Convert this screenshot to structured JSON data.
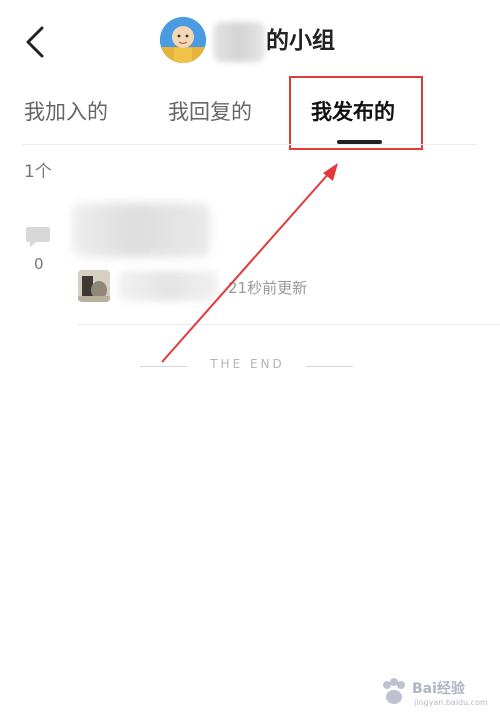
{
  "header": {
    "title": "的小组"
  },
  "tabs": [
    {
      "label": "我加入的",
      "active": false
    },
    {
      "label": "我回复的",
      "active": false
    },
    {
      "label": "我发布的",
      "active": true
    }
  ],
  "list": {
    "count": "1个",
    "items": [
      {
        "comment_count": "0",
        "updated": "21秒前更新"
      }
    ]
  },
  "footer": {
    "end_text": "THE END"
  },
  "watermark": {
    "text": "Bai经验",
    "sub": "jingyan.baidu.com"
  },
  "colors": {
    "highlight": "#e03a3a",
    "active_tab": "#111111",
    "inactive_tab": "#666666"
  },
  "icons": {
    "back": "chevron-left-icon",
    "comment": "comment-bubble-icon"
  }
}
